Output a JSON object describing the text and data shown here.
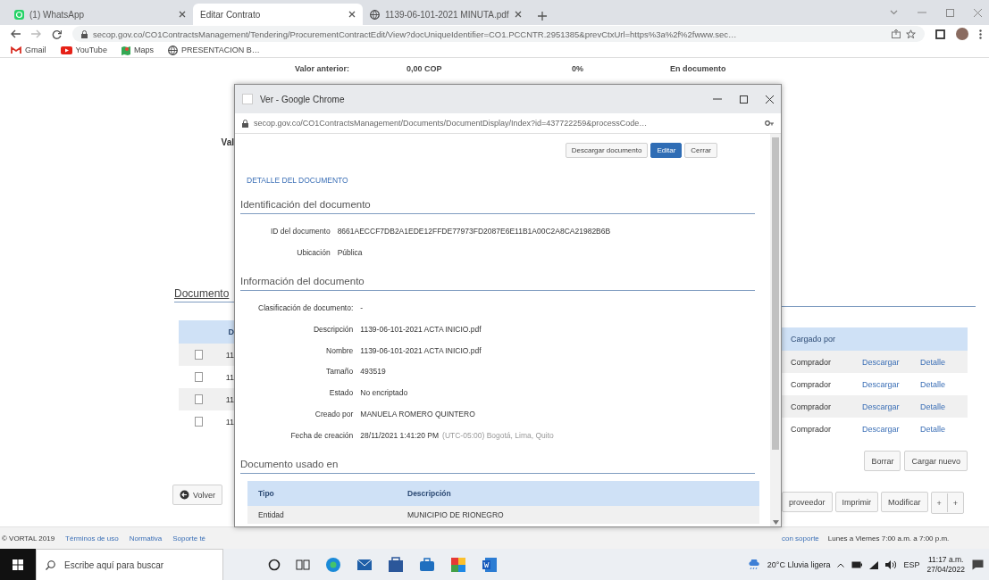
{
  "browser": {
    "tabs": [
      {
        "title": "(1) WhatsApp",
        "selected": false,
        "kind": "chat"
      },
      {
        "title": "Editar Contrato",
        "selected": true,
        "kind": "none"
      },
      {
        "title": "1139-06-101-2021 MINUTA.pdf",
        "selected": false,
        "kind": "globe"
      }
    ],
    "url": "secop.gov.co/CO1ContractsManagement/Tendering/ProcurementContractEdit/View?docUniqueIdentifier=CO1.PCCNTR.2951385&prevCtxUrl=https%3a%2f%2fwww.sec…",
    "bookmarks": [
      {
        "label": "Gmail",
        "kind": "mail"
      },
      {
        "label": "YouTube",
        "kind": "video"
      },
      {
        "label": "Maps",
        "kind": "map"
      },
      {
        "label": "PRESENTACION B…",
        "kind": "globe"
      }
    ]
  },
  "page": {
    "summary_row": [
      "Valor anterior:",
      "0,00 COP",
      "0%",
      "En documento"
    ],
    "side_label": "Val",
    "documents_heading": "Documento",
    "documents_table": {
      "column_1": "D",
      "column_2": "Cargado por",
      "rows": [
        {
          "checked": false,
          "name": "11",
          "uploaded_by": "Comprador",
          "download": "Descargar",
          "detail": "Detalle"
        },
        {
          "checked": false,
          "name": "11",
          "uploaded_by": "Comprador",
          "download": "Descargar",
          "detail": "Detalle"
        },
        {
          "checked": false,
          "name": "11",
          "uploaded_by": "Comprador",
          "download": "Descargar",
          "detail": "Detalle"
        },
        {
          "checked": false,
          "name": "11",
          "uploaded_by": "Comprador",
          "download": "Descargar",
          "detail": "Detalle"
        }
      ]
    },
    "table_buttons": [
      "Borrar",
      "Cargar nuevo"
    ],
    "back_button": "Volver",
    "action_buttons": [
      "proveedor",
      "Imprimir",
      "Modificar"
    ],
    "stepper": [
      "+",
      "+"
    ]
  },
  "popup": {
    "title": "Ver - Google Chrome",
    "url": "secop.gov.co/CO1ContractsManagement/Documents/DocumentDisplay/Index?id=437722259&processCode…",
    "buttons": [
      {
        "label": "Descargar documento",
        "kind": "default"
      },
      {
        "label": "Editar",
        "kind": "primary"
      },
      {
        "label": "Cerrar",
        "kind": "default"
      }
    ],
    "heading": "DETALLE DEL DOCUMENTO",
    "sections": [
      {
        "title": "Identificación del documento",
        "fields": [
          {
            "label": "ID del documento",
            "value": "8661AECCF7DB2A1EDE12FFDE77973FD2087E6E11B1A00C2A8CA21982B6B"
          },
          {
            "label": "Ubicación",
            "value": "Pública"
          }
        ]
      },
      {
        "title": "Información del documento",
        "fields": [
          {
            "label": "Clasificación de documento:",
            "value": "-"
          },
          {
            "label": "Descripción",
            "value": "1139-06-101-2021 ACTA INICIO.pdf"
          },
          {
            "label": "Nombre",
            "value": "1139-06-101-2021 ACTA INICIO.pdf"
          },
          {
            "label": "Tamaño",
            "value": "493519"
          },
          {
            "label": "Estado",
            "value": "No encriptado"
          },
          {
            "label": "Creado por",
            "value": "MANUELA ROMERO QUINTERO"
          },
          {
            "label": "Fecha de creación",
            "value": "28/11/2021 1:41:20 PM",
            "note": "(UTC-05:00) Bogotá, Lima, Quito"
          }
        ]
      }
    ],
    "usage": {
      "title": "Documento usado en",
      "columns": [
        "Tipo",
        "Descripción"
      ],
      "rows": [
        [
          "Entidad",
          "MUNICIPIO DE RIONEGRO"
        ]
      ]
    }
  },
  "footer": {
    "copyright": "© VORTAL 2019",
    "links": [
      "Términos de uso",
      "Normativa",
      "Soporte té"
    ],
    "support": "con soporte",
    "hours": "Lunes a Viernes 7:00 a.m. a 7:00 p.m."
  },
  "taskbar": {
    "search_placeholder": "Escribe aquí para buscar",
    "weather": "20°C Lluvia ligera",
    "language": "ESP",
    "time": "11:17 a.m.",
    "date": "27/04/2022"
  }
}
